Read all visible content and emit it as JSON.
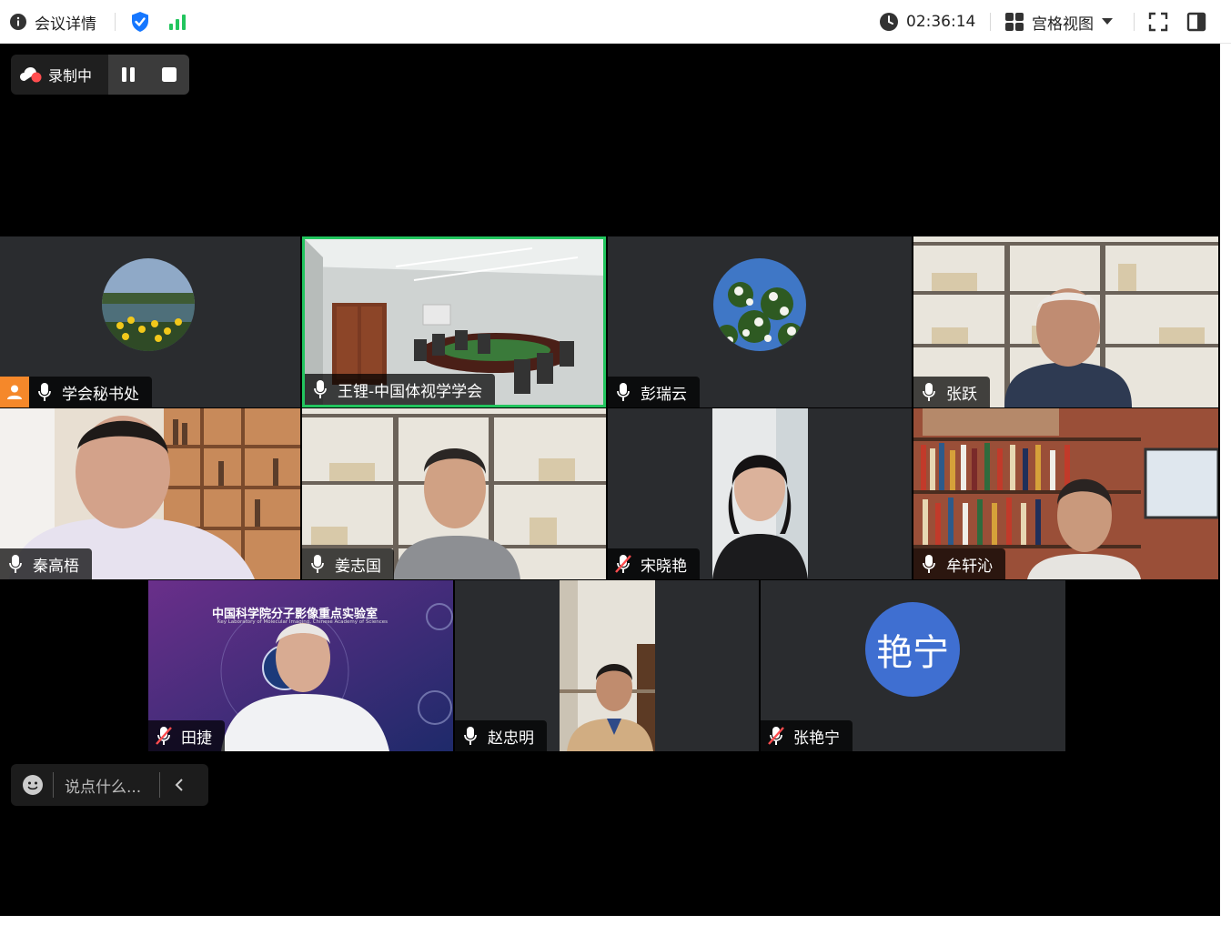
{
  "topbar": {
    "meeting_info": "会议详情",
    "timer": "02:36:14",
    "view_mode": "宫格视图"
  },
  "recording": {
    "status": "录制中"
  },
  "participants": [
    {
      "name": "学会秘书处",
      "mic": "on"
    },
    {
      "name": "王锂-中国体视学学会",
      "mic": "on"
    },
    {
      "name": "彭瑞云",
      "mic": "on"
    },
    {
      "name": "张跃",
      "mic": "on"
    },
    {
      "name": "秦高梧",
      "mic": "on"
    },
    {
      "name": "姜志国",
      "mic": "on"
    },
    {
      "name": "宋晓艳",
      "mic": "muted"
    },
    {
      "name": "牟轩沁",
      "mic": "on"
    },
    {
      "name": "田捷",
      "mic": "muted"
    },
    {
      "name": "赵忠明",
      "mic": "on"
    },
    {
      "name": "张艳宁",
      "mic": "muted"
    }
  ],
  "avatar_text": "艳宁",
  "background_text": {
    "title": "中国科学院分子影像重点实验室",
    "subtitle": "Key Laboratory of Molecular Imaging, Chinese Academy of Sciences"
  },
  "chat": {
    "placeholder": "说点什么..."
  },
  "colors": {
    "accent_blue": "#1677ff",
    "active_border": "#22c55e",
    "signal_green": "#22c55e",
    "host_orange": "#f5882a",
    "muted_red": "#ff4d4f",
    "avatar_blue": "#3f6fd1"
  }
}
